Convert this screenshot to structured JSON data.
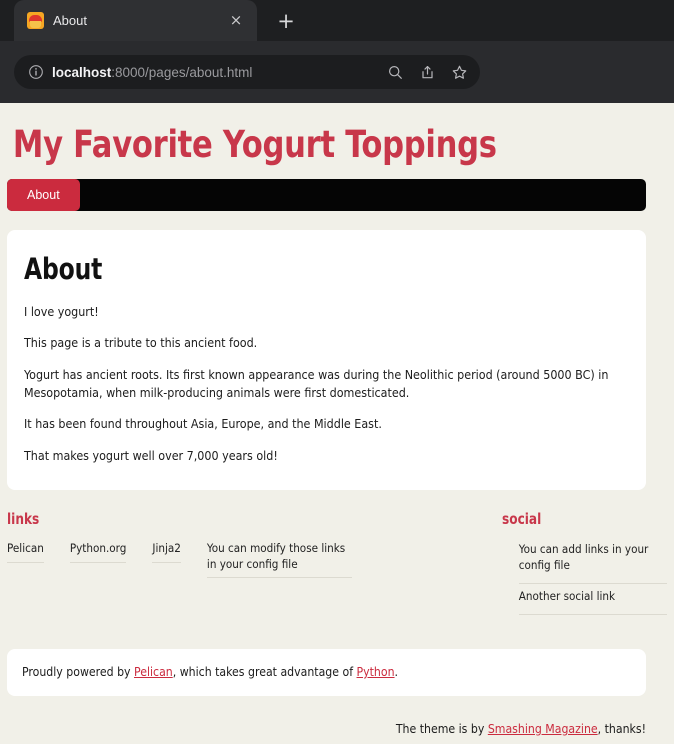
{
  "browser": {
    "tab": {
      "title": "About",
      "favicon_name": "cupcake-favicon",
      "close_label": "×"
    },
    "newtab_label": "+",
    "urlbar": {
      "info_icon": "info-circle-icon",
      "host": "localhost",
      "path": ":8000/pages/about.html",
      "actions": [
        {
          "name": "search-icon",
          "label": "Search"
        },
        {
          "name": "share-icon",
          "label": "Share"
        },
        {
          "name": "bookmark-star-icon",
          "label": "Bookmark"
        }
      ]
    }
  },
  "site": {
    "title": "My Favorite Yogurt Toppings",
    "accent_color": "#cb2b3e",
    "page_background": "#f1f0e8",
    "nav_background": "#050505",
    "nav": [
      {
        "label": "About",
        "active": true
      }
    ]
  },
  "article": {
    "title": "About",
    "paragraphs": [
      "I love yogurt!",
      "This page is a tribute to this ancient food.",
      "Yogurt has ancient roots. Its first known appearance was during the Neolithic period (around 5000 BC) in Mesopotamia, when milk-producing animals were first domesticated.",
      "It has been found throughout Asia, Europe, and the Middle East.",
      "That makes yogurt well over 7,000 years old!"
    ]
  },
  "widgets": {
    "links": {
      "title": "links",
      "items": [
        "Pelican",
        "Python.org",
        "Jinja2",
        "You can modify those links in your config file"
      ]
    },
    "social": {
      "title": "social",
      "items": [
        "You can add links in your config file",
        "Another social link"
      ]
    }
  },
  "footer": {
    "powered_prefix": "Proudly powered by ",
    "powered_link1": "Pelican",
    "powered_middle": ", which takes great advantage of ",
    "powered_link2": "Python",
    "powered_suffix": ".",
    "theme_prefix": "The theme is by ",
    "theme_link": "Smashing Magazine",
    "theme_suffix": ", thanks!"
  }
}
